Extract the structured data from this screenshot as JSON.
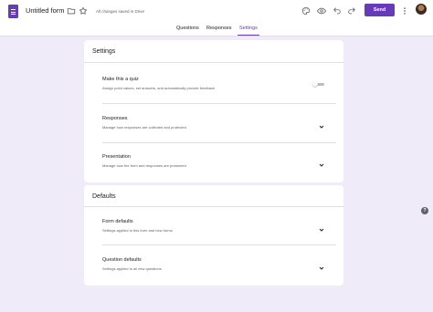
{
  "header": {
    "form_title": "Untitled form",
    "saved_status": "All changes saved in Drive",
    "send_label": "Send",
    "icons": [
      "form-icon",
      "folder-icon",
      "star-icon",
      "palette-icon",
      "preview-eye-icon",
      "undo-icon",
      "redo-icon",
      "more-vert-icon"
    ]
  },
  "tabs": [
    {
      "label": "Questions",
      "active": false
    },
    {
      "label": "Responses",
      "active": false
    },
    {
      "label": "Settings",
      "active": true
    }
  ],
  "settings": {
    "title": "Settings",
    "rows": [
      {
        "title": "Make this a quiz",
        "subtitle": "Assign point values, set answers, and automatically provide feedback",
        "control": "toggle",
        "value": "off"
      },
      {
        "title": "Responses",
        "subtitle": "Manage how responses are collected and protected",
        "control": "chevron"
      },
      {
        "title": "Presentation",
        "subtitle": "Manage how the form and responses are presented",
        "control": "chevron"
      }
    ]
  },
  "defaults": {
    "title": "Defaults",
    "rows": [
      {
        "title": "Form defaults",
        "subtitle": "Settings applied to this form and new forms",
        "control": "chevron"
      },
      {
        "title": "Question defaults",
        "subtitle": "Settings applied to all new questions",
        "control": "chevron"
      }
    ]
  },
  "help_glyph": "?",
  "colors": {
    "accent": "#673ab7",
    "background": "#f0ebf8"
  }
}
